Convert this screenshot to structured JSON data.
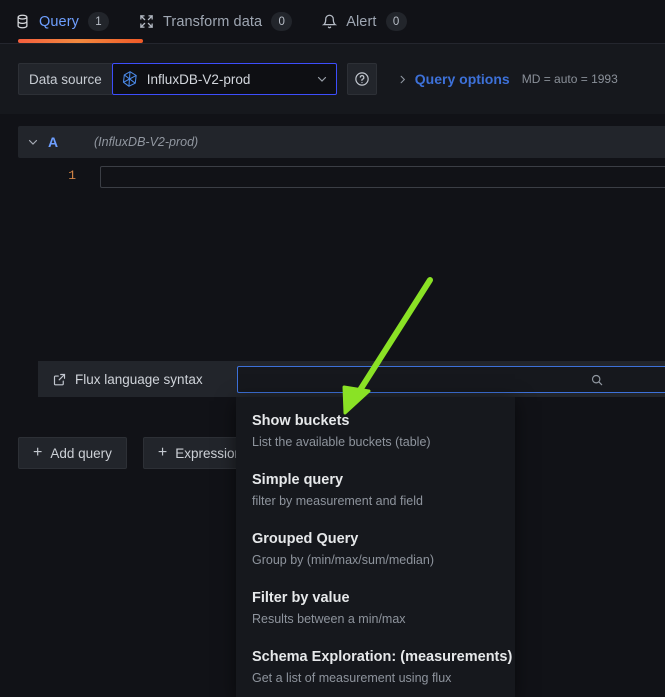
{
  "tabs": [
    {
      "label": "Query",
      "count": "1",
      "icon": "database-icon",
      "active": true
    },
    {
      "label": "Transform data",
      "count": "0",
      "icon": "transform-icon",
      "active": false
    },
    {
      "label": "Alert",
      "count": "0",
      "icon": "bell-icon",
      "active": false
    }
  ],
  "datasource": {
    "label": "Data source",
    "selected": "InfluxDB-V2-prod",
    "help_icon": "question-circle-icon",
    "chevron_icon": "chevron-down-icon",
    "logo_icon": "influxdb-logo-icon"
  },
  "query_options": {
    "expand_icon": "chevron-right-icon",
    "label": "Query options",
    "summary": "MD = auto = 1993"
  },
  "query_row": {
    "collapse_icon": "chevron-down-icon",
    "ref_id": "A",
    "datasource_note": "(InfluxDB-V2-prod)"
  },
  "editor": {
    "line_number": "1",
    "content": ""
  },
  "toolbar": {
    "flux_link_label": "Flux language syntax",
    "flux_link_icon": "external-link-icon",
    "snippet_search_icon": "search-icon",
    "snippet_search_value": ""
  },
  "actions": [
    {
      "label": "Add query",
      "icon": "plus-icon"
    },
    {
      "label": "Expression",
      "icon": "plus-icon"
    }
  ],
  "menu": {
    "items": [
      {
        "title": "Show buckets",
        "desc": "List the available buckets (table)"
      },
      {
        "title": "Simple query",
        "desc": "filter by measurement and field"
      },
      {
        "title": "Grouped Query",
        "desc": "Group by (min/max/sum/median)"
      },
      {
        "title": "Filter by value",
        "desc": "Results between a min/max"
      },
      {
        "title": "Schema Exploration: (measurements)",
        "desc": "Get a list of measurement using flux"
      }
    ]
  },
  "annotation": {
    "arrow_color": "#8ae225",
    "arrow_from": "430,280",
    "arrow_to": "347,410"
  },
  "colors": {
    "background": "#111217",
    "panel": "#16181d",
    "control": "#22252b",
    "accent_blue": "#3d71d9",
    "link_blue": "#6e9fff",
    "tab_underline": "#f05a28",
    "text_primary": "#d3d7dd",
    "text_secondary": "#8e949d"
  }
}
